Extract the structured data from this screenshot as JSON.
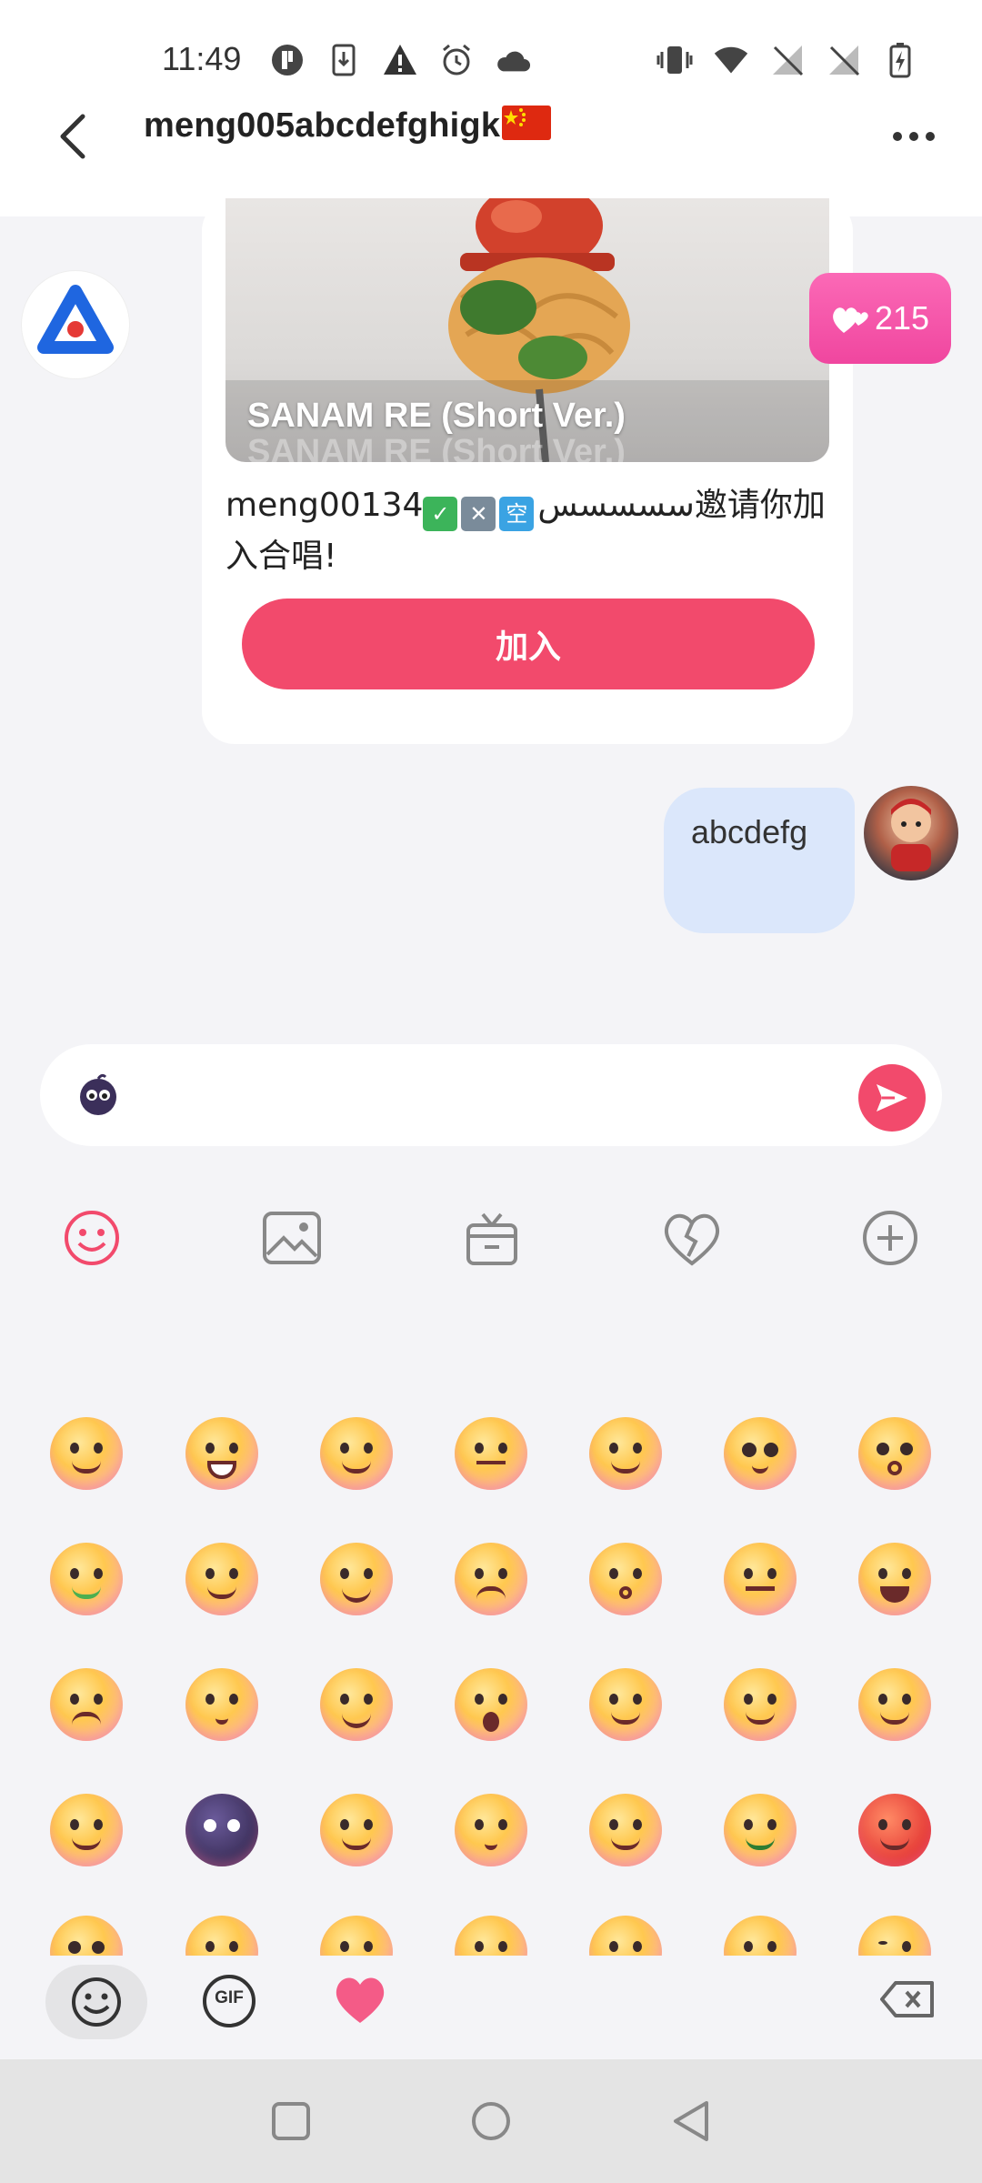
{
  "status_bar": {
    "time": "11:49"
  },
  "header": {
    "title": "meng005abcdefghigk",
    "flag_icon": "china-flag-icon"
  },
  "invite_card": {
    "song_title": "SANAM RE (Short Ver.)",
    "song_title_reflection": "SANAM RE (Short Ver.)",
    "message_prefix": "meng001",
    "message_arabic": "سسسسس",
    "message_suffix": "34邀请你加入合唱!",
    "join_label": "加入"
  },
  "likes_badge": {
    "count": "215"
  },
  "my_message": {
    "text": "abcdefg"
  },
  "colors": {
    "accent": "#f24a6c",
    "badge_pink": "#f0469f",
    "my_bubble": "#dbe7fb"
  },
  "toolbar": {
    "items": [
      "smile-icon",
      "image-icon",
      "gift-icon",
      "duet-icon",
      "plus-icon"
    ]
  },
  "bottom_tabs": {
    "gif_label": "GIF"
  }
}
